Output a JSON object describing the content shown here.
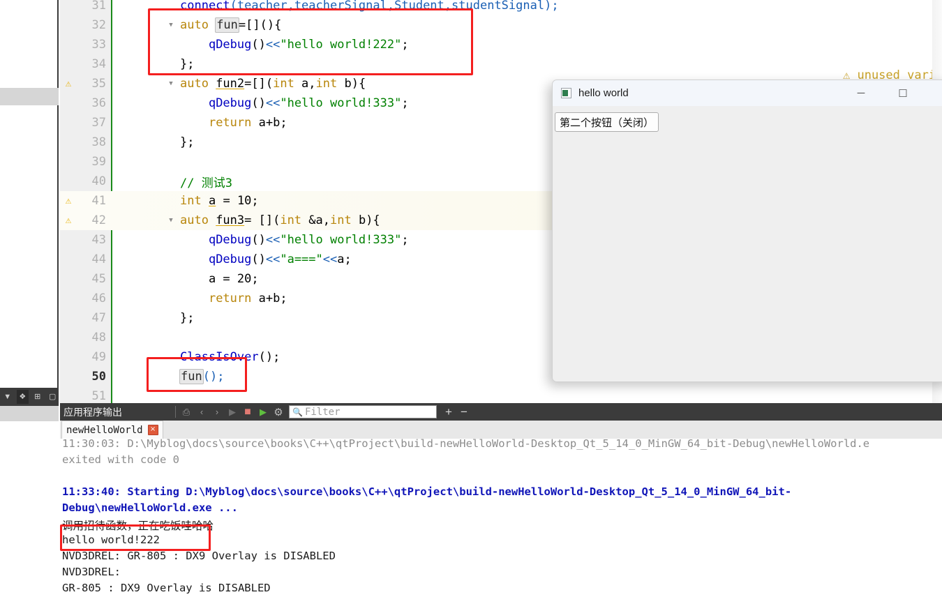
{
  "left_rail": {
    "toolbar_icons": [
      {
        "name": "chevron-down-icon",
        "glyph": "▼"
      },
      {
        "name": "shapes-icon",
        "glyph": "❖"
      },
      {
        "name": "split-add-icon",
        "glyph": "⊞"
      },
      {
        "name": "dropdown-box-icon",
        "glyph": "▢"
      }
    ]
  },
  "editor": {
    "annotation_unused": "⚠ unused variable",
    "lines": [
      {
        "num": "31",
        "warn": false,
        "fold": "",
        "cur": false,
        "hl": false,
        "tokens": [
          {
            "t": "connect",
            "c": "fn"
          },
          {
            "t": "(",
            "c": "op"
          },
          {
            "t": "teacher",
            "c": "typ"
          },
          {
            "t": ",",
            "c": "op"
          },
          {
            "t": "teacherSignal",
            "c": "typ"
          },
          {
            "t": ",",
            "c": "op"
          },
          {
            "t": "Student",
            "c": "typ"
          },
          {
            "t": ",",
            "c": "op"
          },
          {
            "t": "studentSignal",
            "c": "typ"
          },
          {
            "t": ");",
            "c": "op"
          }
        ]
      },
      {
        "num": "32",
        "warn": false,
        "fold": "▼",
        "cur": false,
        "hl": false,
        "tokens": [
          {
            "t": "auto ",
            "c": "kw"
          },
          {
            "t": "fun",
            "c": "box"
          },
          {
            "t": "=[](){",
            "c": "pl"
          }
        ]
      },
      {
        "num": "33",
        "warn": false,
        "fold": "",
        "cur": false,
        "hl": false,
        "tokens": [
          {
            "t": "    ",
            "c": "pl"
          },
          {
            "t": "qDebug",
            "c": "fn"
          },
          {
            "t": "()",
            "c": "pl"
          },
          {
            "t": "<<",
            "c": "op"
          },
          {
            "t": "\"hello world!222\"",
            "c": "str"
          },
          {
            "t": ";",
            "c": "pl"
          }
        ]
      },
      {
        "num": "34",
        "warn": false,
        "fold": "",
        "cur": false,
        "hl": false,
        "tokens": [
          {
            "t": "};",
            "c": "pl"
          }
        ]
      },
      {
        "num": "35",
        "warn": true,
        "fold": "▼",
        "cur": false,
        "hl": false,
        "tokens": [
          {
            "t": "auto ",
            "c": "kw"
          },
          {
            "t": "fun2",
            "c": "uline"
          },
          {
            "t": "=[](",
            "c": "pl"
          },
          {
            "t": "int",
            "c": "kw"
          },
          {
            "t": " a,",
            "c": "pl"
          },
          {
            "t": "int",
            "c": "kw"
          },
          {
            "t": " b){",
            "c": "pl"
          }
        ]
      },
      {
        "num": "36",
        "warn": false,
        "fold": "",
        "cur": false,
        "hl": false,
        "tokens": [
          {
            "t": "    ",
            "c": "pl"
          },
          {
            "t": "qDebug",
            "c": "fn"
          },
          {
            "t": "()",
            "c": "pl"
          },
          {
            "t": "<<",
            "c": "op"
          },
          {
            "t": "\"hello world!333\"",
            "c": "str"
          },
          {
            "t": ";",
            "c": "pl"
          }
        ]
      },
      {
        "num": "37",
        "warn": false,
        "fold": "",
        "cur": false,
        "hl": false,
        "tokens": [
          {
            "t": "    ",
            "c": "pl"
          },
          {
            "t": "return",
            "c": "kw"
          },
          {
            "t": " a+b;",
            "c": "pl"
          }
        ]
      },
      {
        "num": "38",
        "warn": false,
        "fold": "",
        "cur": false,
        "hl": false,
        "tokens": [
          {
            "t": "};",
            "c": "pl"
          }
        ]
      },
      {
        "num": "39",
        "warn": false,
        "fold": "",
        "cur": false,
        "hl": false,
        "tokens": []
      },
      {
        "num": "40",
        "warn": false,
        "fold": "",
        "cur": false,
        "hl": false,
        "tokens": [
          {
            "t": "// 测试3",
            "c": "cmt"
          }
        ]
      },
      {
        "num": "41",
        "warn": true,
        "fold": "",
        "cur": false,
        "hl": true,
        "tokens": [
          {
            "t": "int",
            "c": "kw"
          },
          {
            "t": " ",
            "c": "pl"
          },
          {
            "t": "a",
            "c": "uline"
          },
          {
            "t": " = ",
            "c": "pl"
          },
          {
            "t": "10",
            "c": "num"
          },
          {
            "t": ";",
            "c": "pl"
          }
        ]
      },
      {
        "num": "42",
        "warn": true,
        "fold": "▼",
        "cur": false,
        "hl": true,
        "tokens": [
          {
            "t": "auto ",
            "c": "kw"
          },
          {
            "t": "fun3",
            "c": "uline"
          },
          {
            "t": "= [](",
            "c": "pl"
          },
          {
            "t": "int",
            "c": "kw"
          },
          {
            "t": " &a,",
            "c": "pl"
          },
          {
            "t": "int",
            "c": "kw"
          },
          {
            "t": " b){",
            "c": "pl"
          }
        ]
      },
      {
        "num": "43",
        "warn": false,
        "fold": "",
        "cur": false,
        "hl": false,
        "tokens": [
          {
            "t": "    ",
            "c": "pl"
          },
          {
            "t": "qDebug",
            "c": "fn"
          },
          {
            "t": "()",
            "c": "pl"
          },
          {
            "t": "<<",
            "c": "op"
          },
          {
            "t": "\"hello world!333\"",
            "c": "str"
          },
          {
            "t": ";",
            "c": "pl"
          }
        ]
      },
      {
        "num": "44",
        "warn": false,
        "fold": "",
        "cur": false,
        "hl": false,
        "tokens": [
          {
            "t": "    ",
            "c": "pl"
          },
          {
            "t": "qDebug",
            "c": "fn"
          },
          {
            "t": "()",
            "c": "pl"
          },
          {
            "t": "<<",
            "c": "op"
          },
          {
            "t": "\"a===\"",
            "c": "str"
          },
          {
            "t": "<<",
            "c": "op"
          },
          {
            "t": "a;",
            "c": "pl"
          }
        ]
      },
      {
        "num": "45",
        "warn": false,
        "fold": "",
        "cur": false,
        "hl": false,
        "tokens": [
          {
            "t": "    a = ",
            "c": "pl"
          },
          {
            "t": "20",
            "c": "num"
          },
          {
            "t": ";",
            "c": "pl"
          }
        ]
      },
      {
        "num": "46",
        "warn": false,
        "fold": "",
        "cur": false,
        "hl": false,
        "tokens": [
          {
            "t": "    ",
            "c": "pl"
          },
          {
            "t": "return",
            "c": "kw"
          },
          {
            "t": " a+b;",
            "c": "pl"
          }
        ]
      },
      {
        "num": "47",
        "warn": false,
        "fold": "",
        "cur": false,
        "hl": false,
        "tokens": [
          {
            "t": "};",
            "c": "pl"
          }
        ]
      },
      {
        "num": "48",
        "warn": false,
        "fold": "",
        "cur": false,
        "hl": false,
        "tokens": []
      },
      {
        "num": "49",
        "warn": false,
        "fold": "",
        "cur": false,
        "hl": false,
        "tokens": [
          {
            "t": "ClassIsOver",
            "c": "fn"
          },
          {
            "t": "();",
            "c": "pl"
          }
        ]
      },
      {
        "num": "50",
        "warn": false,
        "fold": "",
        "cur": true,
        "hl": false,
        "tokens": [
          {
            "t": "fun",
            "c": "box"
          },
          {
            "t": "();",
            "c": "op"
          }
        ]
      },
      {
        "num": "51",
        "warn": false,
        "fold": "",
        "cur": false,
        "hl": false,
        "tokens": []
      }
    ]
  },
  "dialog": {
    "title": "hello world",
    "app_icon": "window-app-icon",
    "minimize": "─",
    "maximize": "☐",
    "button_label": "第二个按钮（关闭）"
  },
  "output": {
    "title": "应用程序输出",
    "toolbar_icons": [
      {
        "name": "attach-output-icon",
        "glyph": "⎙"
      },
      {
        "name": "prev-item-icon",
        "glyph": "‹"
      },
      {
        "name": "next-item-icon",
        "glyph": "›"
      },
      {
        "name": "run-icon",
        "glyph": "▶"
      },
      {
        "name": "stop-icon",
        "glyph": "■"
      },
      {
        "name": "run-debug-icon",
        "glyph": "▶"
      },
      {
        "name": "settings-gear-icon",
        "glyph": "⚙"
      }
    ],
    "filter_placeholder": "Filter",
    "filter_value": "",
    "search_icon": "search-icon",
    "zoom_in_label": "+",
    "zoom_out_label": "−",
    "tab_label": "newHelloWorld",
    "tab_close": "×",
    "console_lines": [
      {
        "text": "11:30:03: D:\\Myblog\\docs\\source\\books\\C++\\qtProject\\build-newHelloWorld-Desktop_Qt_5_14_0_MinGW_64_bit-Debug\\newHelloWorld.e",
        "style": "c-gray"
      },
      {
        "text": "exited with code 0",
        "style": "c-gray"
      },
      {
        "text": "",
        "style": "c-gray"
      },
      {
        "text": "11:33:40: Starting D:\\Myblog\\docs\\source\\books\\C++\\qtProject\\build-newHelloWorld-Desktop_Qt_5_14_0_MinGW_64_bit-",
        "style": "c-blue"
      },
      {
        "text": "Debug\\newHelloWorld.exe ...",
        "style": "c-blue"
      },
      {
        "text": "调用招待函数，正在吃饭哇哈哈",
        "style": "c-black"
      },
      {
        "text": "hello world!222",
        "style": "c-black"
      },
      {
        "text": "NVD3DREL: GR-805 : DX9 Overlay is DISABLED",
        "style": "c-black"
      },
      {
        "text": "NVD3DREL:",
        "style": "c-black"
      },
      {
        "text": "GR-805 : DX9 Overlay is DISABLED",
        "style": "c-black"
      }
    ]
  },
  "annotations": {
    "color": "#f41f1f",
    "boxes": [
      {
        "name": "lambda-definition-highlight"
      },
      {
        "name": "lambda-call-highlight"
      },
      {
        "name": "console-output-highlight"
      }
    ]
  }
}
